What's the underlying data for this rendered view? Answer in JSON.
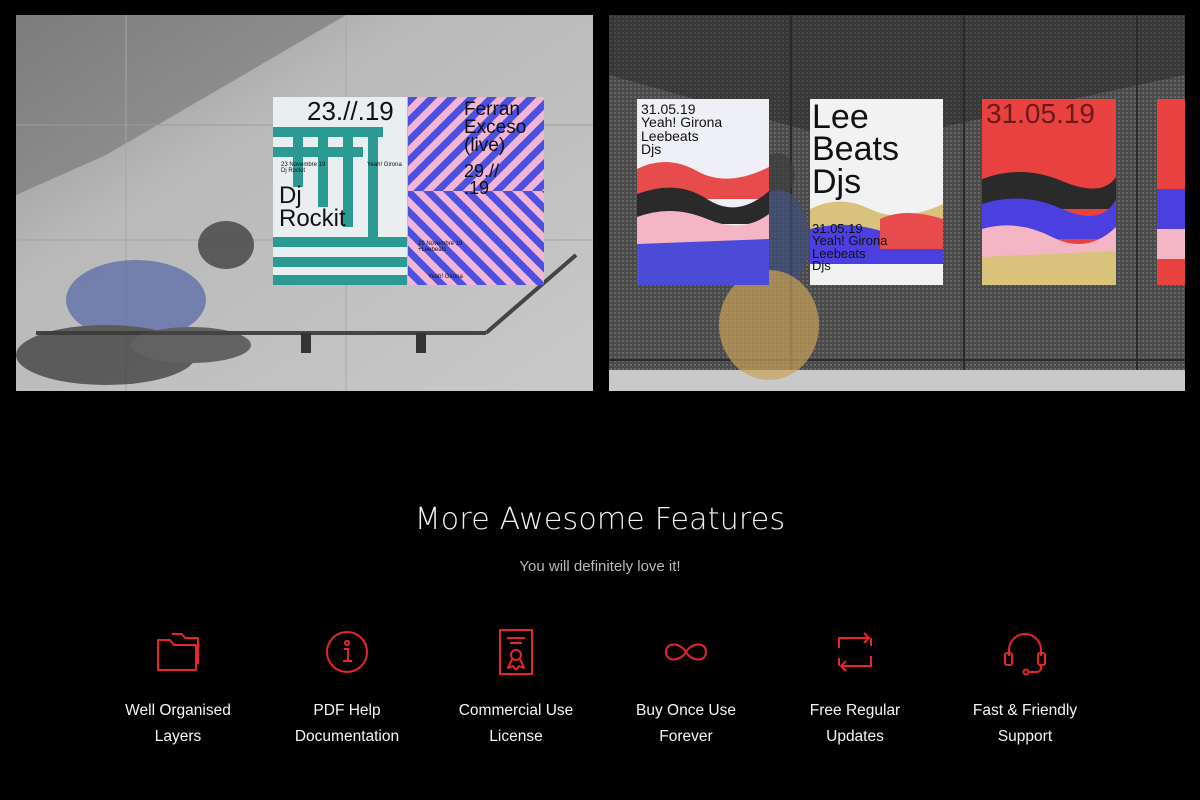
{
  "photos": {
    "left": {
      "poster_a": {
        "date": "23.//.19",
        "meta_left": "23 Novembre 19\nDj Rockit",
        "meta_right": "Yeah! Girona",
        "name": "Dj\nRockit"
      },
      "poster_b": {
        "name": "Ferran\nExceso\n(live)",
        "date": "29.//\n.19",
        "meta": "29 Novembre 19\n+Leebeats",
        "venue": "Yeah! Girona"
      }
    },
    "right": {
      "poster_a": {
        "text": "31.05.19\nYeah! Girona\nLeebeats\nDjs"
      },
      "poster_b": {
        "title": "Lee\nBeats\nDjs",
        "sub": "31.05.19\nYeah! Girona\nLeebeats\nDjs"
      },
      "poster_c": {
        "date": "31.05.19"
      }
    }
  },
  "heading": "More Awesome Features",
  "subheading": "You will definitely love it!",
  "colors": {
    "accent": "#e8242c",
    "background": "#000000"
  },
  "features": [
    {
      "icon": "folder-icon",
      "label": "Well Organised\nLayers"
    },
    {
      "icon": "info-icon",
      "label": "PDF Help\nDocumentation"
    },
    {
      "icon": "certificate-icon",
      "label": "Commercial Use\nLicense"
    },
    {
      "icon": "infinity-icon",
      "label": "Buy Once Use\nForever"
    },
    {
      "icon": "refresh-icon",
      "label": "Free Regular\nUpdates"
    },
    {
      "icon": "headset-icon",
      "label": "Fast & Friendly\nSupport"
    }
  ]
}
